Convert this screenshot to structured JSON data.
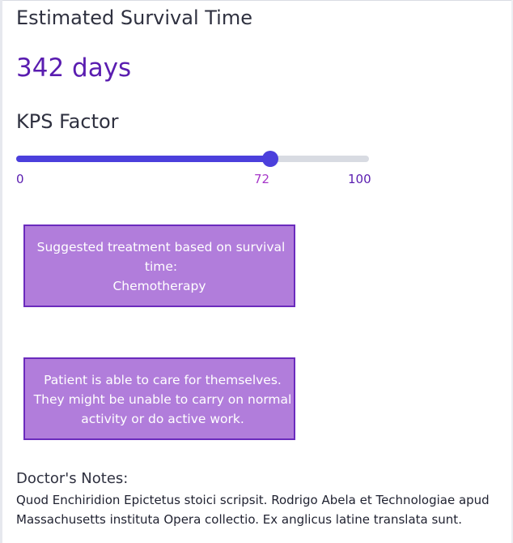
{
  "survival": {
    "title": "Estimated Survival Time",
    "value": "342 days"
  },
  "kps": {
    "label": "KPS Factor",
    "min": 0,
    "max": 100,
    "value": 72,
    "min_label": "0",
    "value_label": "72",
    "max_label": "100"
  },
  "treatment": {
    "prefix": "Suggested treatment based on survival time:",
    "value": "Chemotherapy"
  },
  "functional_status": {
    "text": "Patient is able to care for themselves. They might be unable to carry on normal activity or do active work."
  },
  "notes": {
    "heading": "Doctor's Notes:",
    "body": "Quod Enchiridion Epictetus stoici scripsit. Rodrigo Abela et Technologiae apud Massachusetts instituta Opera collectio. Ex anglicus latine translata sunt."
  },
  "colors": {
    "accent": "#5a1db0",
    "slider_fill": "#4b3fdc",
    "box_background": "#b17ddb",
    "box_border": "#6b2bbd"
  }
}
